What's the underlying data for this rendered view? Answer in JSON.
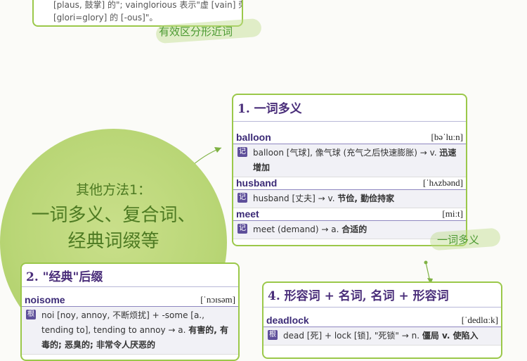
{
  "top_card": {
    "line1": "[plaus, 鼓掌] 的\"; vainglorious 表示\"虚 [vain] 荣",
    "line2": "[glori=glory] 的 [-ous]\"。"
  },
  "tags": {
    "near_shape": "有效区分形近词",
    "polysemy": "一词多义"
  },
  "circle": {
    "line1": "其他方法1：",
    "line2": "一词多义、复合词、",
    "line3": "经典词缀等"
  },
  "card_polysemy": {
    "title": "1. 一词多义",
    "entries": [
      {
        "word": "balloon",
        "phonetic": "[bəˈluːn]",
        "def_plain": "balloon [气球], 像气球 (充气之后快速膨胀) → v.",
        "def_bold": "迅速增加"
      },
      {
        "word": "husband",
        "phonetic": "[ˈhʌzbənd]",
        "def_plain": "husband [丈夫] → v.",
        "def_bold": "节俭, 勤俭持家"
      },
      {
        "word": "meet",
        "phonetic": "[miːt]",
        "def_plain": "meet (demand) → a.",
        "def_bold": "合适的"
      }
    ]
  },
  "card_affix": {
    "title": "2. \"经典\"后缀",
    "entries": [
      {
        "word": "noisome",
        "phonetic": "[ˈnɔɪsəm]",
        "def_plain": "noi [noy, annoy, 不断烦扰] + -some [a., tending to], tending to annoy → a.",
        "def_bold": "有害的, 有毒的; 恶臭的; 非常令人厌恶的"
      }
    ]
  },
  "card_compound": {
    "title": "4. 形容词 + 名词, 名词 + 形容词",
    "entries": [
      {
        "word": "deadlock",
        "phonetic": "[ˈdedlɑːk]",
        "def_plain": "dead [死] + lock [锁], \"死锁\" → n.",
        "def_bold": "僵局 v. 使陷入"
      }
    ]
  },
  "badge_labels": {
    "ji": "记",
    "gen": "根"
  },
  "colors": {
    "accent_green": "#9bc84a",
    "title_purple": "#4a2e7a",
    "badge_purple": "#5e4f9a"
  }
}
